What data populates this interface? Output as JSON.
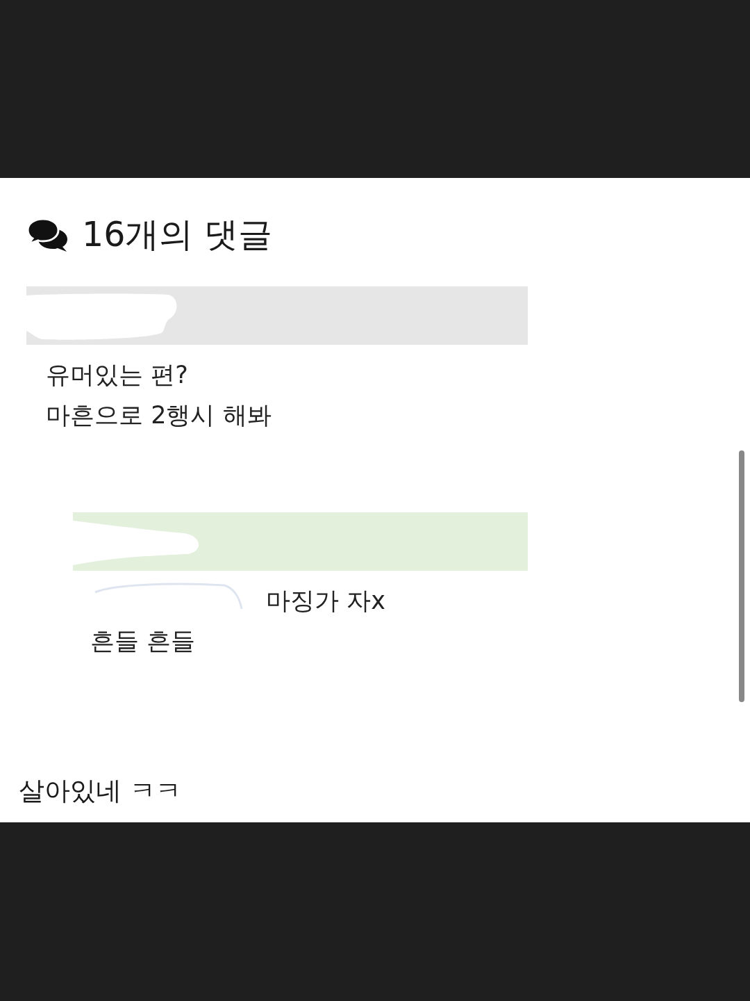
{
  "comments_header": {
    "title": "16개의 댓글"
  },
  "comments": [
    {
      "kind": "comment",
      "author_redacted": true,
      "lines": [
        {
          "text": "유머있는 편?",
          "redacted_prefix": false
        },
        {
          "text": "마흔으로 2행시 해봐",
          "redacted_prefix": false
        }
      ]
    },
    {
      "kind": "reply",
      "author_redacted": true,
      "lines": [
        {
          "text": "마징가 자x",
          "redacted_prefix": true
        },
        {
          "text": "흔들 흔들",
          "redacted_prefix": false
        }
      ]
    }
  ],
  "caption": "살아있네 ㅋㅋ"
}
